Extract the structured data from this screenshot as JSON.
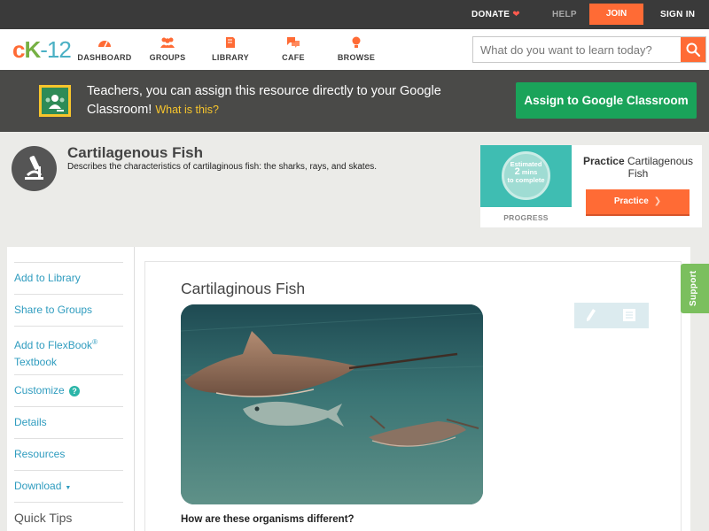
{
  "topbar": {
    "donate": "DONATE",
    "help": "HELP",
    "join": "JOIN",
    "signin": "SIGN IN"
  },
  "logo": {
    "c": "c",
    "k": "K",
    "n": "-12"
  },
  "nav": {
    "items": [
      {
        "label": "DASHBOARD",
        "icon": "dashboard-icon"
      },
      {
        "label": "GROUPS",
        "icon": "groups-icon"
      },
      {
        "label": "LIBRARY",
        "icon": "library-icon"
      },
      {
        "label": "CAFE",
        "icon": "cafe-icon"
      },
      {
        "label": "BROWSE",
        "icon": "browse-icon"
      }
    ],
    "search_placeholder": "What do you want to learn today?"
  },
  "banner": {
    "text": "Teachers, you can assign this resource directly to your Google Classroom!",
    "what": "What is this?",
    "assign_label": "Assign to Google Classroom"
  },
  "resource": {
    "title": "Cartilagenous Fish",
    "description": "Describes the characteristics of cartilaginous fish: the sharks, rays, and skates."
  },
  "practice": {
    "estimated": "Estimated",
    "mins": "2",
    "mins_label": "mins",
    "to_complete": "to complete",
    "progress": "PROGRESS",
    "title_bold": "Practice",
    "title_rest": "Cartilagenous Fish",
    "button": "Practice"
  },
  "sidebar": {
    "add_library": "Add to Library",
    "share_groups": "Share to Groups",
    "add_flexbook": "Add to FlexBook",
    "flexbook_reg": "®",
    "textbook": "Textbook",
    "customize": "Customize",
    "help_q": "?",
    "details": "Details",
    "resources": "Resources",
    "download": "Download",
    "quick_tips": "Quick Tips"
  },
  "content": {
    "title": "Cartilaginous Fish",
    "question": "How are these organisms different?"
  },
  "support": "Support",
  "colors": {
    "accent_orange": "#ff6b35",
    "green": "#1aa35a",
    "link_blue": "#2f9cbf",
    "support_green": "#7bbf5e"
  }
}
